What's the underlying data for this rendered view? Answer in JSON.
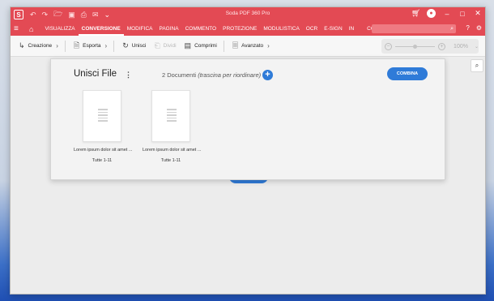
{
  "app": {
    "title": "Soda PDF 360 Pro",
    "logo_letter": "S"
  },
  "quick_access": [
    "undo",
    "redo",
    "open",
    "save",
    "print",
    "email",
    "more"
  ],
  "menu": {
    "items": [
      {
        "label": "VISUALIZZA"
      },
      {
        "label": "CONVERSIONE"
      },
      {
        "label": "MODIFICA"
      },
      {
        "label": "PAGINA"
      },
      {
        "label": "COMMENTO"
      },
      {
        "label": "PROTEZIONE"
      },
      {
        "label": "MODULISTICA"
      },
      {
        "label": "OCR"
      },
      {
        "label": "E-SIGN"
      },
      {
        "label": "IN"
      },
      {
        "label": "CONV"
      }
    ],
    "active": "CONVERSIONE",
    "search_placeholder": ""
  },
  "toolbar": {
    "creazione": "Creazione",
    "esporta": "Esporta",
    "unisci": "Unisci",
    "dividi": "Dividi",
    "comprimi": "Comprimi",
    "avanzato": "Avanzato"
  },
  "zoom": {
    "value": "100%"
  },
  "panel": {
    "title": "Unisci File",
    "doc_count": "2 Documenti",
    "doc_hint": "(trascina per riordinare)",
    "combine_label": "COMBINA",
    "documents": [
      {
        "name": "Lorem ipsum dolor sit amet ...",
        "pages": "Tutte 1-11"
      },
      {
        "name": "Lorem ipsum dolor sit amet ...",
        "pages": "Tutte 1-11"
      }
    ]
  },
  "colors": {
    "brand": "#e34a54",
    "accent": "#2f7bd8"
  }
}
